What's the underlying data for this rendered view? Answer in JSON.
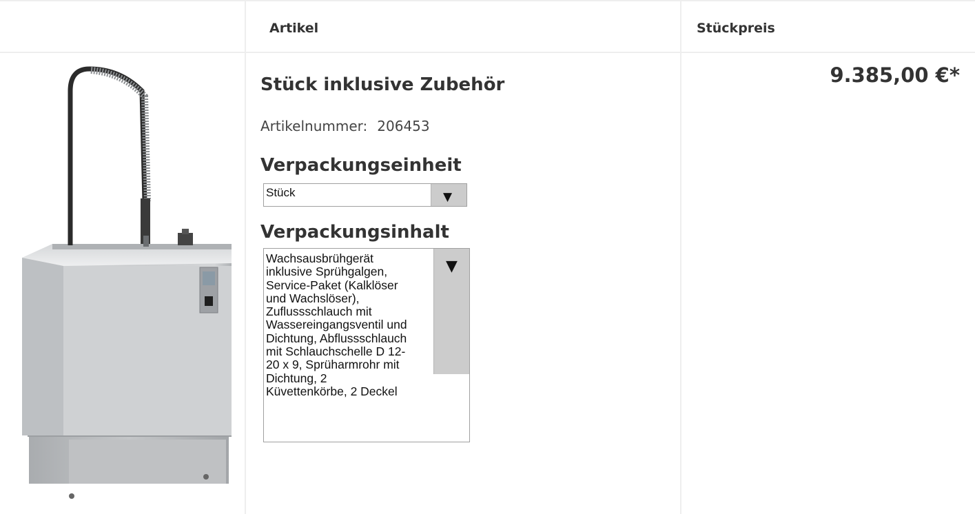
{
  "header": {
    "col_article": "Artikel",
    "col_price": "Stückpreis"
  },
  "product": {
    "image_icon": "wax-boiling-unit-image",
    "title": "Stück inklusive Zubehör",
    "article_number_label": "Artikelnummer:",
    "article_number": "206453",
    "packaging_unit_heading": "Verpackungseinheit",
    "packaging_unit_value": "Stück",
    "packaging_content_heading": "Verpackungsinhalt",
    "packaging_content_text": "Wachsausbrühgerät\ninklusive Sprühgalgen,\nService-Paket (Kalklöser\nund Wachslöser),\nZuflussschlauch mit\nWassereingangsventil und\nDichtung, Abflussschlauch\nmit Schlauchschelle D 12-\n20 x 9, Sprüharmrohr mit\nDichtung, 2\nKüvettenkörbe, 2 Deckel",
    "dropdown_arrow": "▼",
    "price": "9.385,00 €*"
  }
}
